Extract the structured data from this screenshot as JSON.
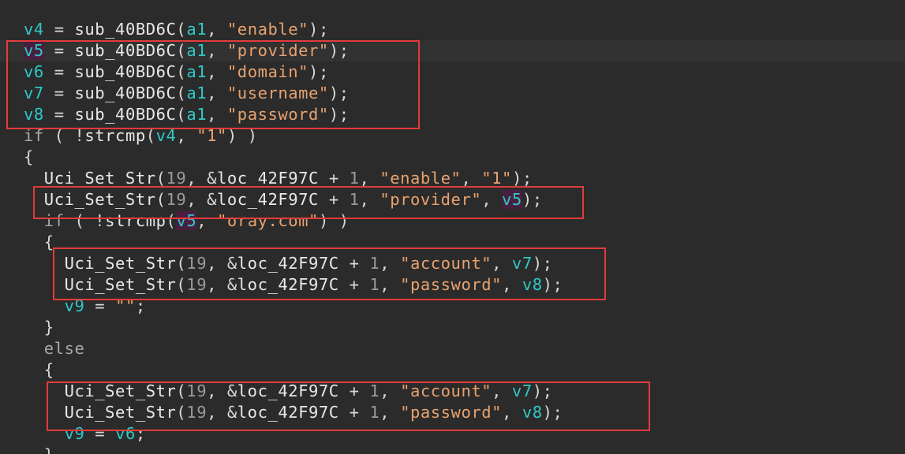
{
  "code_lines": [
    "v4 = sub_40BD6C(a1, \"enable\");",
    "v5 = sub_40BD6C(a1, \"provider\");",
    "v6 = sub_40BD6C(a1, \"domain\");",
    "v7 = sub_40BD6C(a1, \"username\");",
    "v8 = sub_40BD6C(a1, \"password\");",
    "if ( !strcmp(v4, \"1\") )",
    "{",
    "  Uci_Set_Str(19, &loc_42F97C + 1, \"enable\", \"1\");",
    "  Uci_Set_Str(19, &loc_42F97C + 1, \"provider\", v5);",
    "  if ( !strcmp(v5, \"oray.com\") )",
    "  {",
    "    Uci_Set_Str(19, &loc_42F97C + 1, \"account\", v7);",
    "    Uci_Set_Str(19, &loc_42F97C + 1, \"password\", v8);",
    "    v9 = \"\";",
    "  }",
    "  else",
    "  {",
    "    Uci_Set_Str(19, &loc_42F97C + 1, \"account\", v7);",
    "    Uci_Set_Str(19, &loc_42F97C + 1, \"password\", v8);",
    "    v9 = v6;",
    "  }"
  ],
  "colors": {
    "background": "#2b2b2b",
    "variable": "#2ec9c9",
    "variable_highlight_bg": "#48203f",
    "function": "#e8e8e8",
    "string": "#e8a26f",
    "number": "#9a9a9a",
    "keyword": "#a8a8a8",
    "highlight_box": "#e23b3b"
  }
}
